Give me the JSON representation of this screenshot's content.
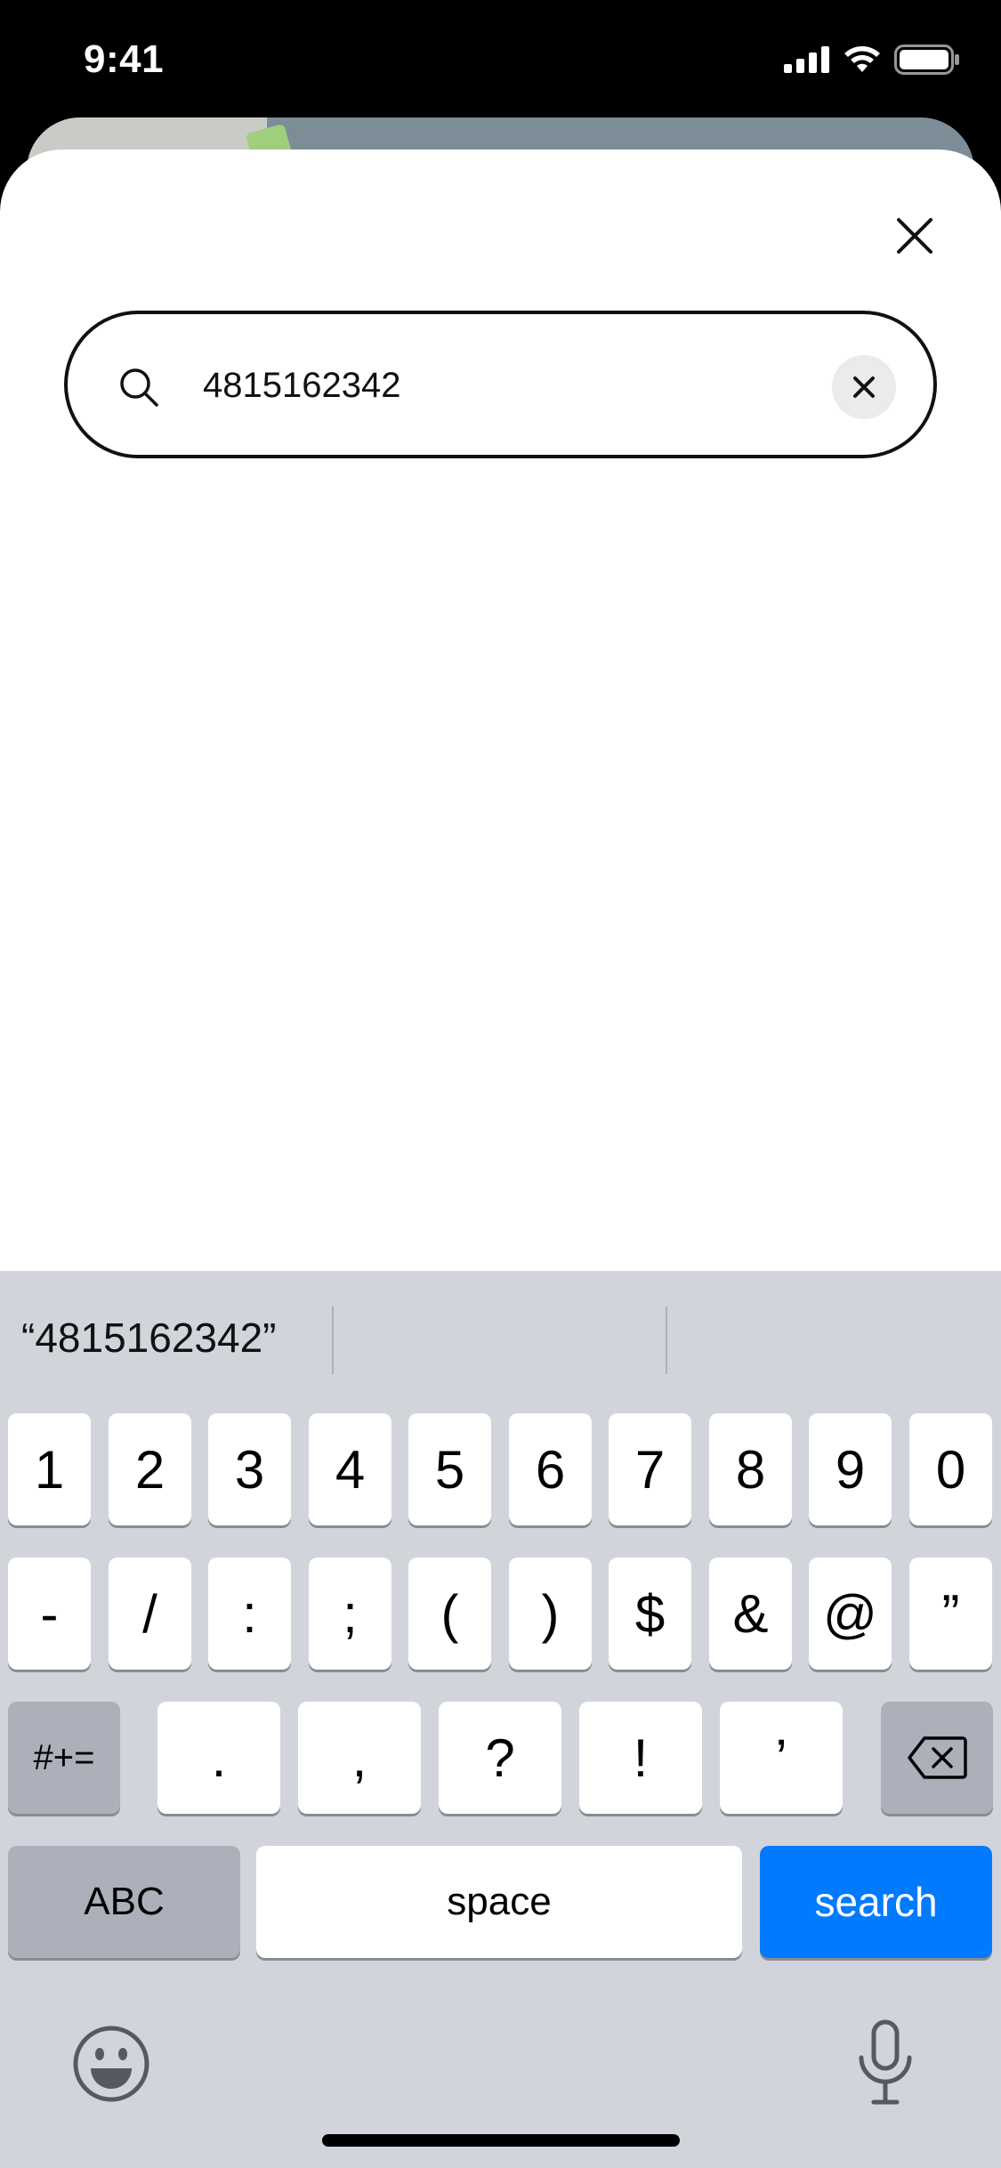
{
  "status_bar": {
    "time": "9:41",
    "icons": [
      "signal-icon",
      "wifi-icon",
      "battery-icon"
    ]
  },
  "search": {
    "value": "4815162342",
    "placeholder": ""
  },
  "suggestions": [
    "“4815162342”",
    "",
    ""
  ],
  "keyboard": {
    "row1": [
      "1",
      "2",
      "3",
      "4",
      "5",
      "6",
      "7",
      "8",
      "9",
      "0"
    ],
    "row2": [
      "-",
      "/",
      ":",
      ";",
      "(",
      ")",
      "$",
      "&",
      "@",
      "”"
    ],
    "row3_mode": "#+=",
    "row3": [
      ".",
      ",",
      "?",
      "!",
      "’"
    ],
    "abc": "ABC",
    "space": "space",
    "search": "search"
  },
  "colors": {
    "accent": "#007aff",
    "keyboard_bg": "#d1d4db",
    "key_dark": "#abb0bb"
  },
  "icons": {
    "close": "close-icon",
    "search": "search-icon",
    "clear": "clear-icon",
    "delete": "backspace-icon",
    "emoji": "emoji-icon",
    "mic": "microphone-icon"
  }
}
